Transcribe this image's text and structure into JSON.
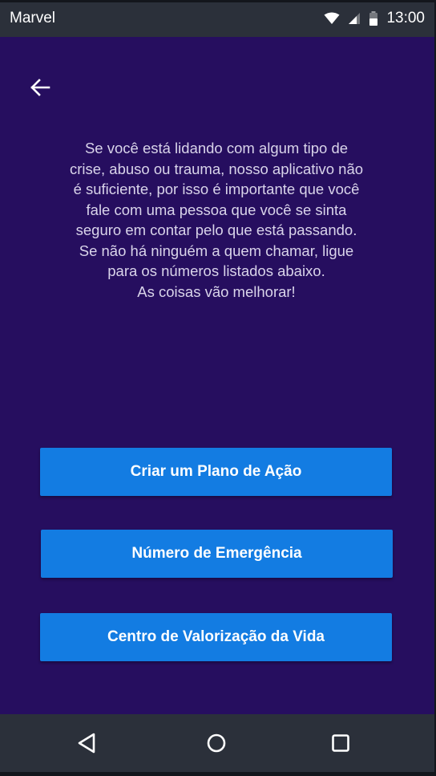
{
  "status_bar": {
    "app_name": "Marvel",
    "time": "13:00",
    "icons": [
      "wifi-icon",
      "cell-signal-icon",
      "battery-icon"
    ]
  },
  "header": {
    "back_icon": "arrow-left-icon"
  },
  "message": {
    "lines": [
      "Se você está lidando com algum tipo de",
      "crise, abuso ou trauma, nosso aplicativo não",
      "é suficiente, por isso é importante que você",
      "fale com uma pessoa que você se sinta",
      "seguro em contar pelo que está passando.",
      "Se não há ninguém a quem chamar, ligue",
      "para os números listados abaixo.",
      "As coisas vão melhorar!"
    ]
  },
  "actions": {
    "plan_label": "Criar um Plano de Ação",
    "emergency_label": "Número de Emergência",
    "cvv_label": "Centro de Valorização da Vida"
  },
  "nav_bar": {
    "icons": [
      "nav-back-icon",
      "nav-home-icon",
      "nav-recents-icon"
    ]
  },
  "colors": {
    "background": "#260e5f",
    "system_bars": "#2b303a",
    "button": "#137ce2",
    "message_text": "#d9d4ea"
  }
}
